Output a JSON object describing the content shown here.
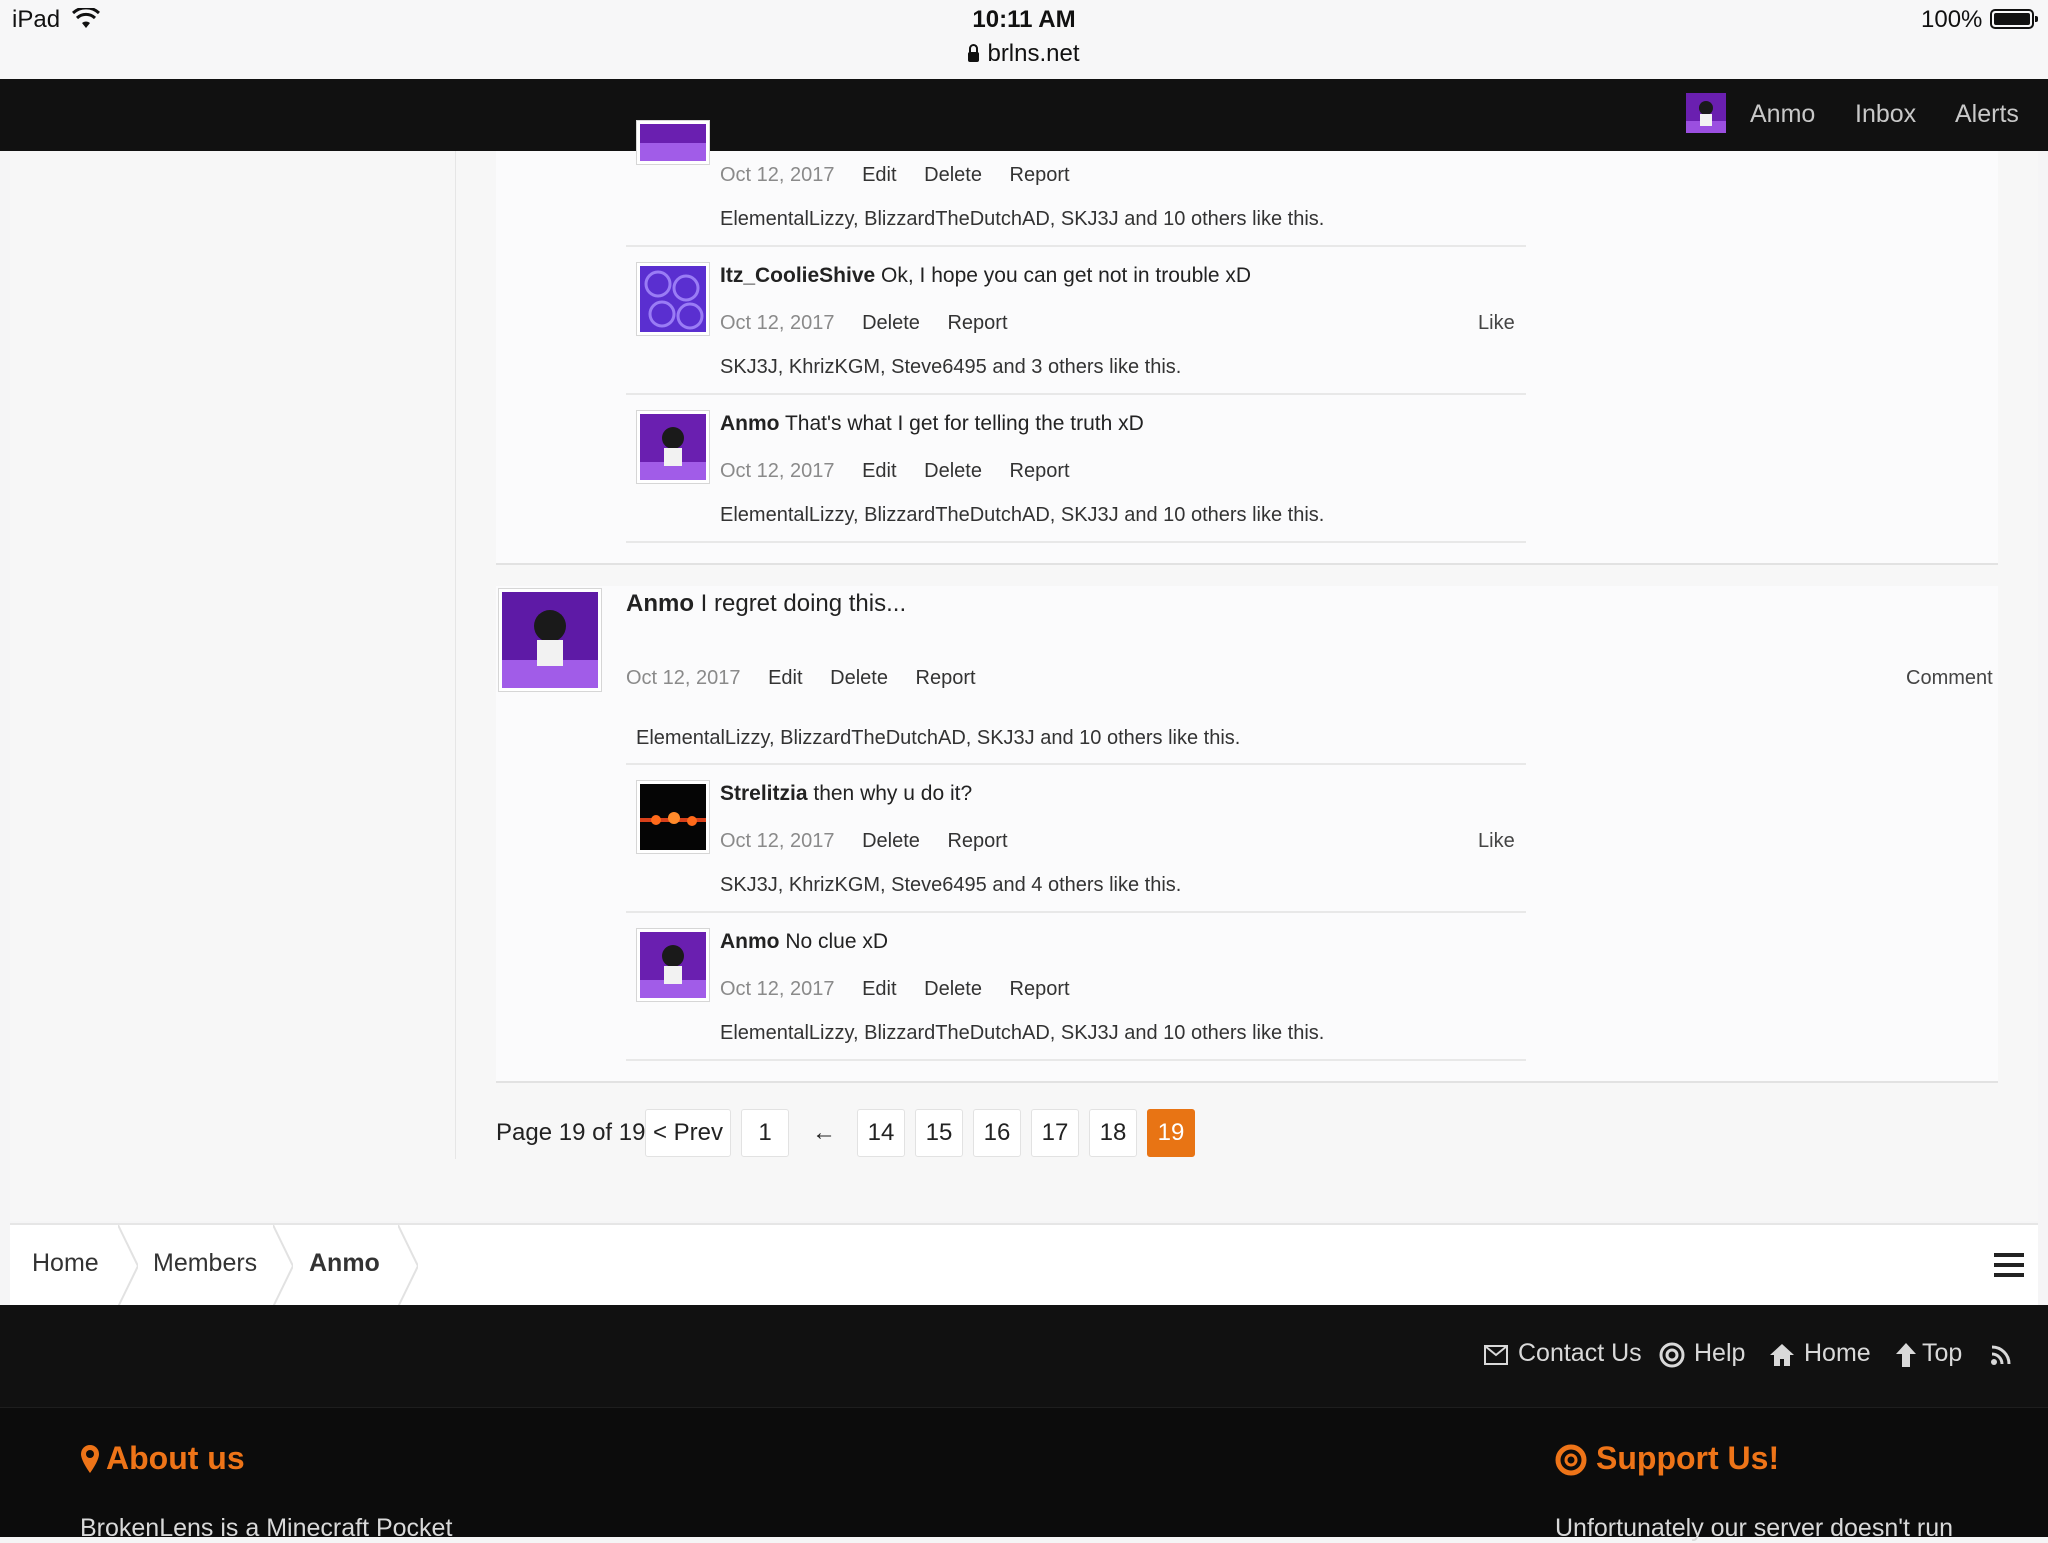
{
  "status_bar": {
    "device": "iPad",
    "time": "10:11 AM",
    "domain": "brlns.net",
    "battery": "100%"
  },
  "nav": {
    "username": "Anmo",
    "inbox": "Inbox",
    "alerts": "Alerts"
  },
  "post1_comments": [
    {
      "date": "Oct 12, 2017",
      "actions": [
        "Edit",
        "Delete",
        "Report"
      ],
      "likes_names": "ElementalLizzy, BlizzardTheDutchAD, SKJ3J",
      "likes_and": " and ",
      "likes_others": "10 others",
      "likes_suffix": " like this."
    },
    {
      "author": "Itz_CoolieShive",
      "text": " Ok, I hope you can get not in trouble xD",
      "date": "Oct 12, 2017",
      "actions": [
        "Delete",
        "Report"
      ],
      "like_label": "Like",
      "likes_names": "SKJ3J, KhrizKGM, Steve6495",
      "likes_and": " and ",
      "likes_others": "3 others",
      "likes_suffix": " like this."
    },
    {
      "author": "Anmo",
      "text": " That's what I get for telling the truth xD",
      "date": "Oct 12, 2017",
      "actions": [
        "Edit",
        "Delete",
        "Report"
      ],
      "likes_names": "ElementalLizzy, BlizzardTheDutchAD, SKJ3J",
      "likes_and": " and ",
      "likes_others": "10 others",
      "likes_suffix": " like this."
    }
  ],
  "post2": {
    "author": "Anmo",
    "text": " I regret doing this...",
    "date": "Oct 12, 2017",
    "actions": [
      "Edit",
      "Delete",
      "Report"
    ],
    "comment_label": "Comment",
    "likes_names": "ElementalLizzy, BlizzardTheDutchAD, SKJ3J",
    "likes_and": " and ",
    "likes_others": "10 others",
    "likes_suffix": " like this.",
    "comments": [
      {
        "author": "Strelitzia",
        "text": " then why u do it?",
        "date": "Oct 12, 2017",
        "actions": [
          "Delete",
          "Report"
        ],
        "like_label": "Like",
        "likes_names": "SKJ3J, KhrizKGM, Steve6495",
        "likes_and": " and ",
        "likes_others": "4 others",
        "likes_suffix": " like this."
      },
      {
        "author": "Anmo",
        "text": " No clue xD",
        "date": "Oct 12, 2017",
        "actions": [
          "Edit",
          "Delete",
          "Report"
        ],
        "likes_names": "ElementalLizzy, BlizzardTheDutchAD, SKJ3J",
        "likes_and": " and ",
        "likes_others": "10 others",
        "likes_suffix": " like this."
      }
    ]
  },
  "pagination": {
    "label": "Page 19 of 19",
    "prev": "< Prev",
    "first": "1",
    "skip": "←",
    "pages": [
      "14",
      "15",
      "16",
      "17",
      "18"
    ],
    "current": "19"
  },
  "breadcrumb": {
    "items": [
      "Home",
      "Members",
      "Anmo"
    ]
  },
  "footer": {
    "links": {
      "contact": "Contact Us",
      "help": "Help",
      "home": "Home",
      "top": "Top"
    },
    "about_heading": "About us",
    "about_text": "BrokenLens is a Minecraft Pocket",
    "support_heading": "Support Us!",
    "support_text": "Unfortunately our server doesn't run"
  },
  "colors": {
    "accent": "#ee7418",
    "pagination_current": "#e87414",
    "nav_bg": "#111111"
  }
}
